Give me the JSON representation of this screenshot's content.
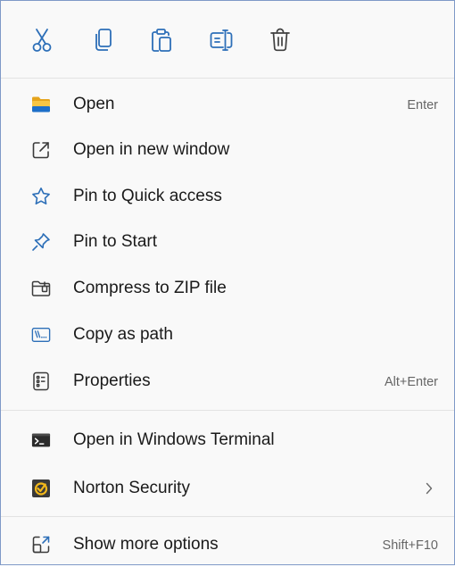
{
  "toolbar": {
    "icons": [
      "cut-icon",
      "copy-icon",
      "paste-icon",
      "rename-icon",
      "delete-icon"
    ]
  },
  "menu": {
    "items": [
      {
        "label": "Open",
        "shortcut": "Enter",
        "icon": "folder-icon"
      },
      {
        "label": "Open in new window",
        "shortcut": "",
        "icon": "open-new-window-icon"
      },
      {
        "label": "Pin to Quick access",
        "shortcut": "",
        "icon": "star-icon"
      },
      {
        "label": "Pin to Start",
        "shortcut": "",
        "icon": "pin-icon"
      },
      {
        "label": "Compress to ZIP file",
        "shortcut": "",
        "icon": "zip-folder-icon"
      },
      {
        "label": "Copy as path",
        "shortcut": "",
        "icon": "copy-path-icon"
      },
      {
        "label": "Properties",
        "shortcut": "Alt+Enter",
        "icon": "properties-icon"
      },
      {
        "label": "Open in Windows Terminal",
        "shortcut": "",
        "icon": "terminal-icon"
      },
      {
        "label": "Norton Security",
        "shortcut": "",
        "icon": "norton-icon",
        "submenu": true
      },
      {
        "label": "Show more options",
        "shortcut": "Shift+F10",
        "icon": "show-more-icon"
      }
    ]
  },
  "colors": {
    "accent": "#0067c0",
    "folder": "#f2b72b",
    "background": "#f9f9f9",
    "border": "#7f99c7"
  }
}
